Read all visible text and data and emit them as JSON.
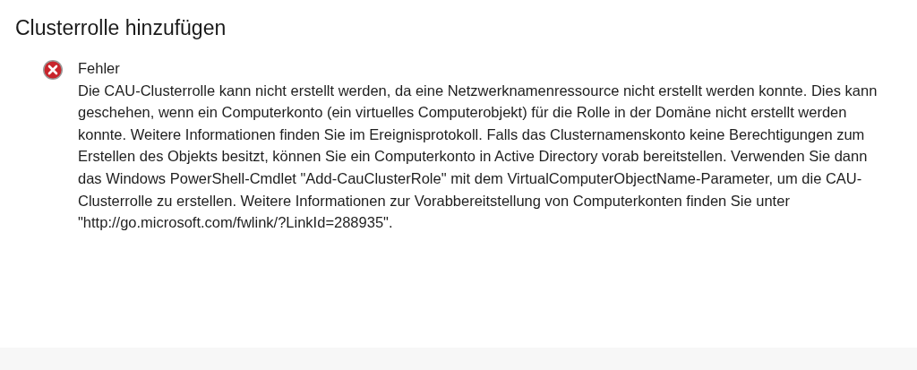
{
  "window": {
    "title": "Clusterrolle hinzufügen"
  },
  "message": {
    "kind": "error",
    "heading": "Fehler",
    "text": "Die CAU-Clusterrolle kann nicht erstellt werden, da eine Netzwerknamenressource nicht erstellt werden konnte. Dies kann geschehen, wenn ein Computerkonto (ein virtuelles Computerobjekt) für die Rolle in der Domäne nicht erstellt werden konnte. Weitere Informationen finden Sie im Ereignisprotokoll. Falls das Clusternamenskonto keine Berechtigungen zum Erstellen des Objekts besitzt, können Sie ein Computerkonto in Active Directory vorab bereitstellen. Verwenden Sie dann das Windows PowerShell-Cmdlet \"Add-CauClusterRole\" mit dem VirtualComputerObjectName-Parameter, um die CAU-Clusterrolle zu erstellen. Weitere Informationen zur Vorabbereitstellung von Computerkonten finden Sie unter \"http://go.microsoft.com/fwlink/?LinkId=288935\"."
  }
}
